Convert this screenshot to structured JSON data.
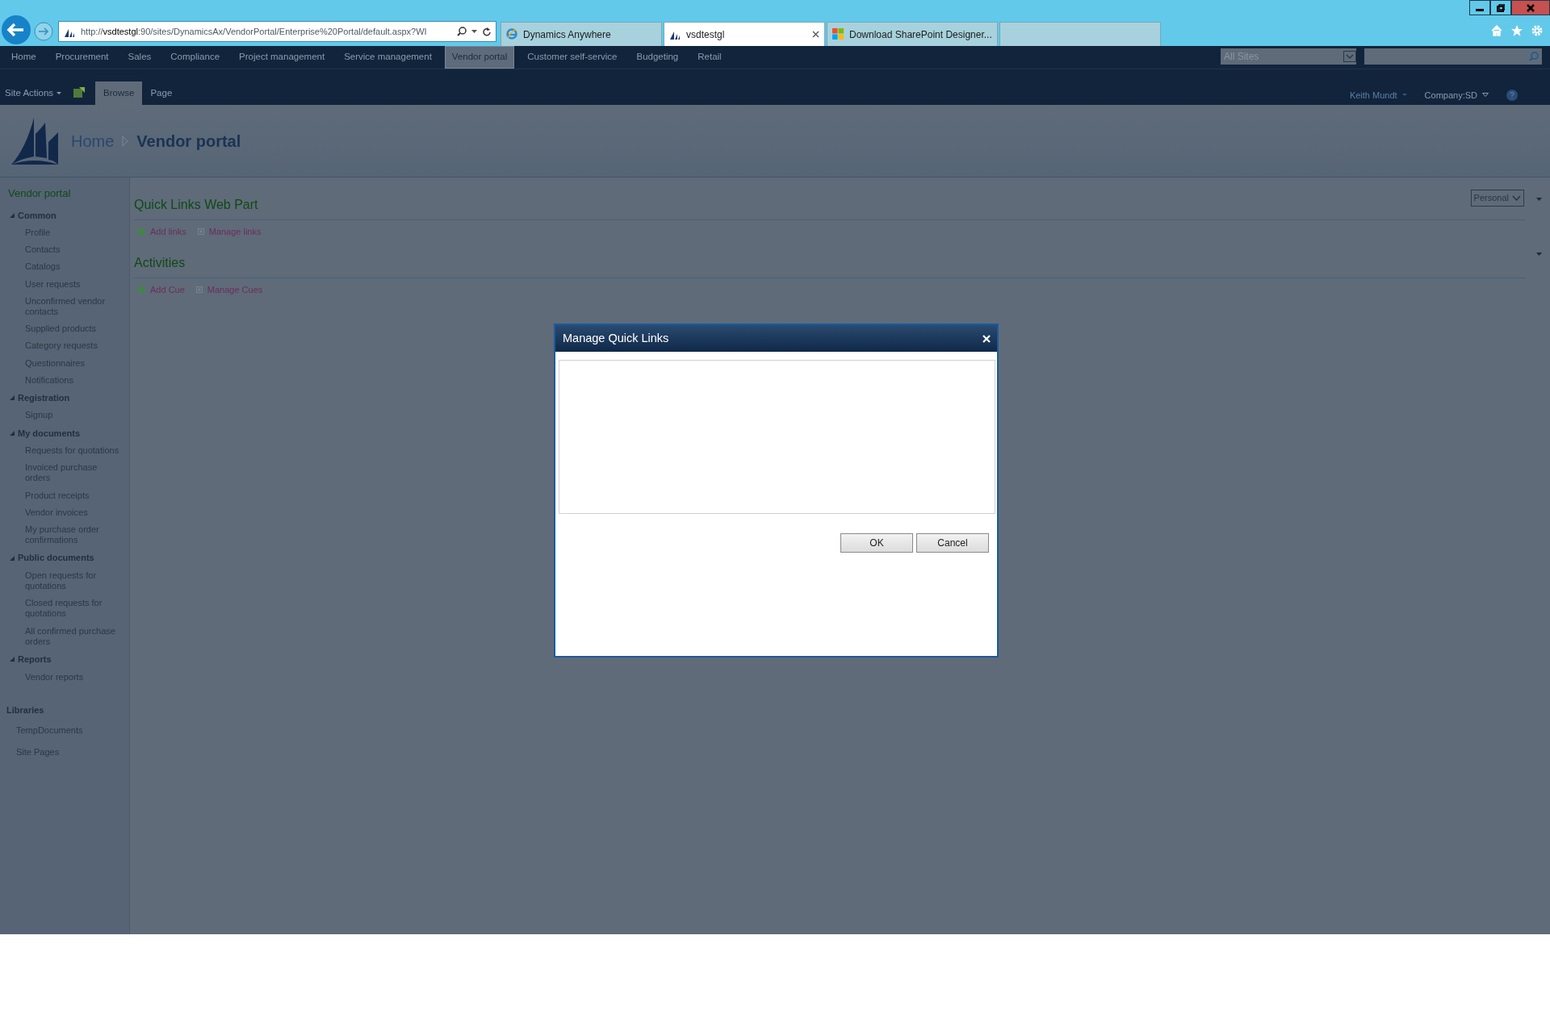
{
  "browser": {
    "url": "http://**vsdtestgl**:90/sites/DynamicsAx/VendorPortal/Enterprise%20Portal/default.aspx?WI",
    "tabs": [
      {
        "label": "Dynamics Anywhere",
        "kind": "ie",
        "selected": false
      },
      {
        "label": "vsdtestgl",
        "kind": "dynamics",
        "selected": true
      },
      {
        "label": "Download SharePoint Designer...",
        "kind": "microsoft",
        "selected": false
      }
    ]
  },
  "top_nav": [
    {
      "label": "Home",
      "selected": false
    },
    {
      "label": "Procurement",
      "selected": false
    },
    {
      "label": "Sales",
      "selected": false
    },
    {
      "label": "Compliance",
      "selected": false
    },
    {
      "label": "Project management",
      "selected": false
    },
    {
      "label": "Service management",
      "selected": false
    },
    {
      "label": "Vendor portal",
      "selected": true
    },
    {
      "label": "Customer self-service",
      "selected": false
    },
    {
      "label": "Budgeting",
      "selected": false
    },
    {
      "label": "Retail",
      "selected": false
    }
  ],
  "site_search": {
    "scope": "All Sites"
  },
  "ribbon": {
    "site_actions": "Site Actions",
    "tabs": [
      {
        "label": "Browse",
        "selected": true
      },
      {
        "label": "Page",
        "selected": false
      }
    ],
    "user": "Keith Mundt",
    "company": "Company:SD"
  },
  "breadcrumb": {
    "home": "Home",
    "current": "Vendor portal"
  },
  "sidebar": {
    "title": "Vendor portal",
    "groups": [
      {
        "label": "Common",
        "expanded": true,
        "children": [
          "Profile",
          "Contacts",
          "Catalogs",
          "User requests",
          "Unconfirmed vendor contacts",
          "Supplied products",
          "Category requests",
          "Questionnaires",
          "Notifications"
        ]
      },
      {
        "label": "Registration",
        "expanded": true,
        "children": [
          "Signup"
        ]
      },
      {
        "label": "My documents",
        "expanded": true,
        "children": [
          "Requests for quotations",
          "Invoiced purchase orders",
          "Product receipts",
          "Vendor invoices",
          "My purchase order confirmations"
        ]
      },
      {
        "label": "Public documents",
        "expanded": true,
        "children": [
          "Open requests for quotations",
          "Closed requests for quotations",
          "All confirmed purchase orders"
        ]
      },
      {
        "label": "Reports",
        "expanded": true,
        "children": [
          "Vendor reports"
        ]
      }
    ],
    "libraries": {
      "label": "Libraries",
      "items": [
        "TempDocuments",
        "Site Pages"
      ]
    }
  },
  "view_select": "Personal",
  "web_parts": [
    {
      "title": "Quick Links Web Part",
      "actions": [
        {
          "label": "Add links",
          "kind": "add"
        },
        {
          "label": "Manage links",
          "kind": "manage"
        }
      ]
    },
    {
      "title": "Activities",
      "actions": [
        {
          "label": "Add Cue",
          "kind": "add"
        },
        {
          "label": "Manage Cues",
          "kind": "manage"
        }
      ]
    }
  ],
  "dialog": {
    "title": "Manage Quick Links",
    "buttons": [
      "OK",
      "Cancel"
    ]
  }
}
